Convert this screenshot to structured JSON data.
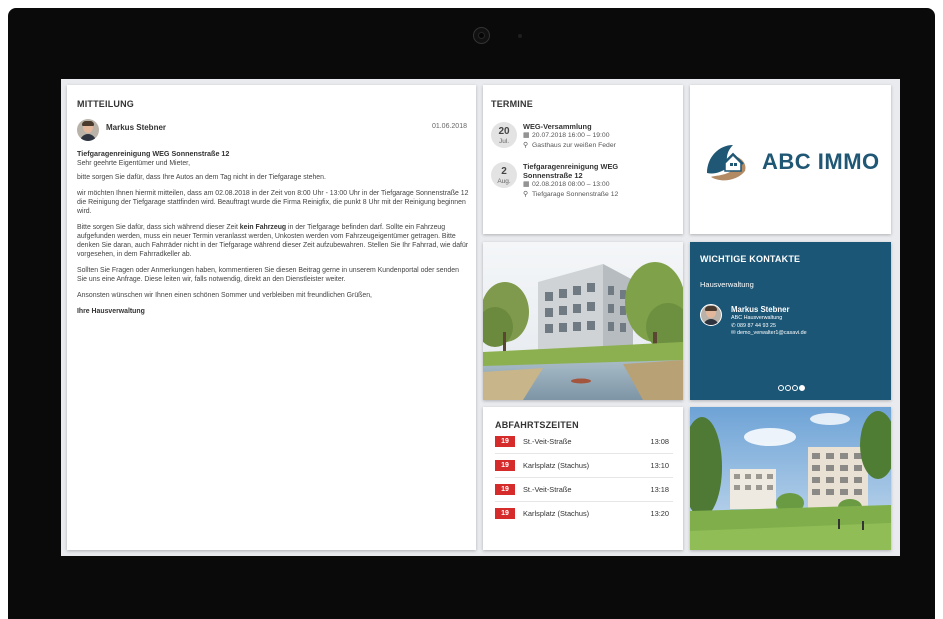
{
  "mitteilung": {
    "title": "MITTEILUNG",
    "author": "Markus Stebner",
    "date": "01.06.2018",
    "subject": "Tiefgaragenreinigung WEG Sonnenstraße 12",
    "salutation": "Sehr geehrte Eigentümer und Mieter,",
    "p1": "bitte sorgen Sie dafür, dass Ihre Autos an dem Tag nicht in der Tiefgarage stehen.",
    "p2": "wir möchten Ihnen hiermit mitteilen, dass am 02.08.2018 in der Zeit von 8:00 Uhr - 13:00 Uhr in der Tiefgarage Sonnenstraße 12 die Reinigung der Tiefgarage stattfinden wird. Beauftragt wurde die Firma Reinigfix, die punkt 8 Uhr mit der Reinigung beginnen wird.",
    "p3_before": "Bitte sorgen Sie dafür, dass sich während dieser Zeit ",
    "p3_bold": "kein Fahrzeug",
    "p3_after": " in der Tiefgarage befinden darf. Sollte ein Fahrzeug aufgefunden werden, muss ein neuer Termin veranlasst werden, Unkosten werden vom Fahrzeugeigentümer getragen. Bitte denken Sie daran, auch Fahrräder nicht in der Tiefgarage während dieser Zeit aufzubewahren. Stellen Sie Ihr Fahrrad, wie dafür vorgesehen, in dem Fahrradkeller ab.",
    "p4": "Sollten Sie Fragen oder Anmerkungen haben, kommentieren Sie diesen Beitrag gerne in unserem Kundenportal oder senden Sie uns eine Anfrage. Diese leiten wir, falls notwendig, direkt an den Dienstleister weiter.",
    "p5": "Ansonsten wünschen wir Ihnen einen schönen Sommer und verbleiben mit freundlichen Grüßen,",
    "signature": "Ihre Hausverwaltung"
  },
  "termine": {
    "title": "TERMINE",
    "events": [
      {
        "day": "20",
        "month": "Jul.",
        "title": "WEG-Versammlung",
        "datetime": "20.07.2018 16:00 – 19:00",
        "location": "Gasthaus zur weißen Feder",
        "calendar_icon": "calendar-icon",
        "location_icon": "map-pin-icon"
      },
      {
        "day": "2",
        "month": "Aug.",
        "title": "Tiefgaragenreinigung WEG Sonnenstraße 12",
        "datetime": "02.08.2018 08:00 – 13:00",
        "location": "Tiefgarage Sonnenstraße 12",
        "calendar_icon": "calendar-icon",
        "location_icon": "map-pin-icon"
      }
    ]
  },
  "logo": {
    "text": "ABC IMMO",
    "colors": {
      "blue": "#1f5775",
      "tan": "#b28a63"
    }
  },
  "kontakte": {
    "title": "WICHTIGE KONTAKTE",
    "category": "Hausverwaltung",
    "name": "Markus Stebner",
    "company": "ABC Hausverwaltung",
    "phone": "089 87 44 93 25",
    "email": "demo_verwalter1@casavi.de",
    "phone_icon": "phone-icon",
    "email_icon": "envelope-icon",
    "background": "#1c5676",
    "carousel": {
      "total": 4,
      "active": 4
    }
  },
  "abfahrtszeiten": {
    "title": "ABFAHRTSZEITEN",
    "line_color": "#d62b2b",
    "departures": [
      {
        "line": "19",
        "destination": "St.-Veit-Straße",
        "time": "13:08"
      },
      {
        "line": "19",
        "destination": "Karlsplatz (Stachus)",
        "time": "13:10"
      },
      {
        "line": "19",
        "destination": "St.-Veit-Straße",
        "time": "13:18"
      },
      {
        "line": "19",
        "destination": "Karlsplatz (Stachus)",
        "time": "13:20"
      }
    ]
  }
}
